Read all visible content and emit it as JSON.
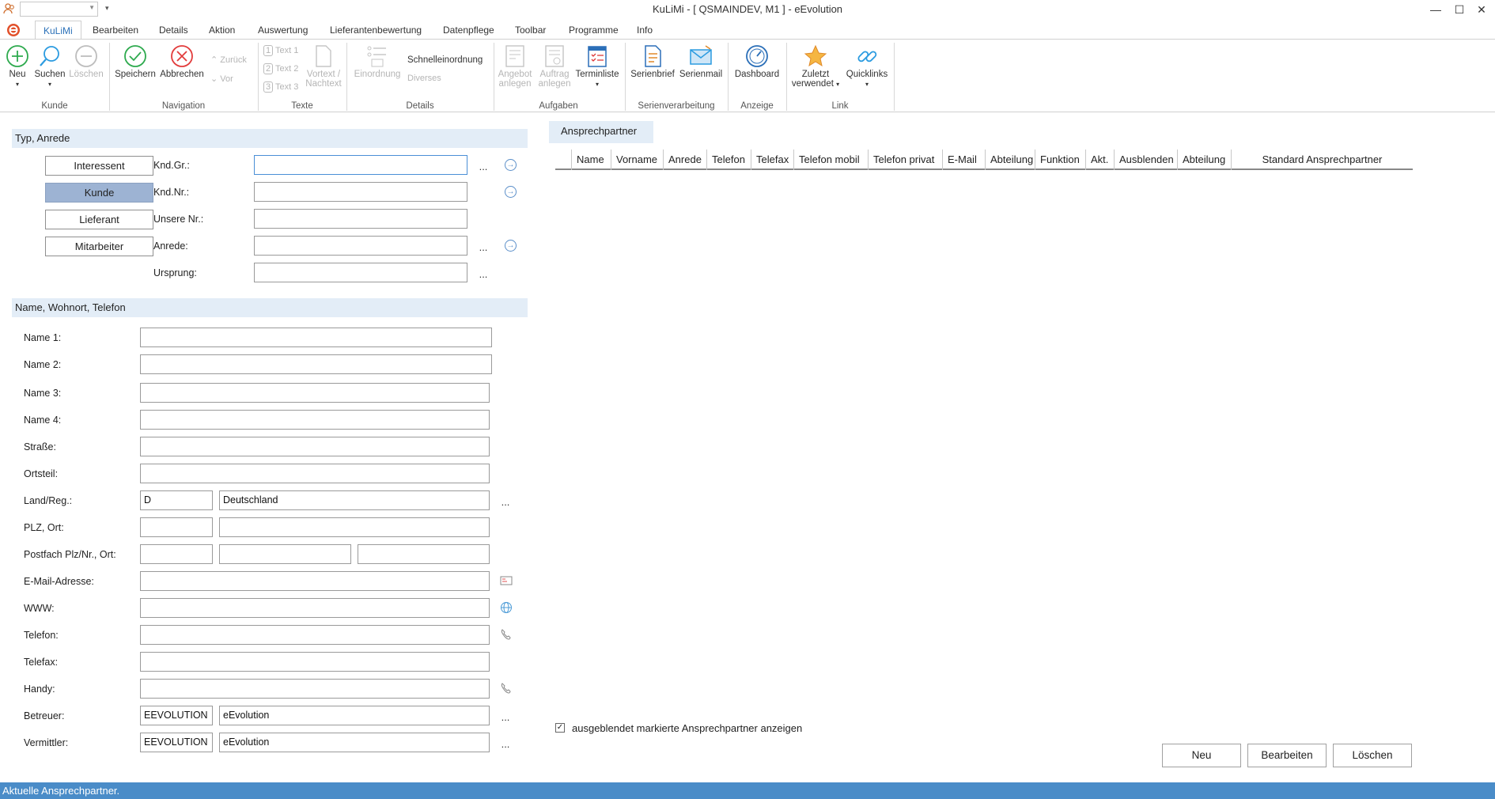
{
  "window": {
    "title": "KuLiMi - [ QSMAINDEV, M1 ]  -  eEvolution",
    "minimize": "—",
    "maximize": "☐",
    "close": "✕"
  },
  "tabs": [
    "KuLiMi",
    "Bearbeiten",
    "Details",
    "Aktion",
    "Auswertung",
    "Lieferantenbewertung",
    "Datenpflege",
    "Toolbar",
    "Programme",
    "Info"
  ],
  "ribbon": {
    "kunde": {
      "label": "Kunde",
      "neu": "Neu",
      "suchen": "Suchen",
      "loeschen": "Löschen"
    },
    "navigation": {
      "label": "Navigation",
      "speichern": "Speichern",
      "abbrechen": "Abbrechen",
      "zurueck": "Zurück",
      "vor": "Vor"
    },
    "texte": {
      "label": "Texte",
      "text1": "Text 1",
      "text2": "Text 2",
      "text3": "Text 3",
      "vortext1": "Vortext /",
      "vortext2": "Nachtext"
    },
    "details": {
      "label": "Details",
      "einordnung": "Einordnung",
      "schnelleinordnung": "Schnelleinordnung",
      "diverses": "Diverses"
    },
    "aufgaben": {
      "label": "Aufgaben",
      "angebot1": "Angebot",
      "angebot2": "anlegen",
      "auftrag1": "Auftrag",
      "auftrag2": "anlegen",
      "terminliste": "Terminliste"
    },
    "serien": {
      "label": "Serienverarbeitung",
      "serienbrief": "Serienbrief",
      "serienmail": "Serienmail"
    },
    "anzeige": {
      "label": "Anzeige",
      "dashboard": "Dashboard"
    },
    "link": {
      "label": "Link",
      "zuletzt1": "Zuletzt",
      "zuletzt2": "verwendet",
      "quicklinks": "Quicklinks"
    }
  },
  "typ_section": {
    "header": "Typ, Anrede",
    "types": [
      "Interessent",
      "Kunde",
      "Lieferant",
      "Mitarbeiter"
    ],
    "selected": "Kunde",
    "fields": [
      {
        "label": "Knd.Gr.:",
        "value": ""
      },
      {
        "label": "Knd.Nr.:",
        "value": ""
      },
      {
        "label": "Unsere Nr.:",
        "value": ""
      },
      {
        "label": "Anrede:",
        "value": ""
      },
      {
        "label": "Ursprung:",
        "value": ""
      }
    ],
    "dots": "..."
  },
  "name_section": {
    "header": "Name, Wohnort, Telefon",
    "labels": {
      "name1": "Name 1:",
      "name2": "Name 2:",
      "name3": "Name 3:",
      "name4": "Name 4:",
      "strasse": "Straße:",
      "ortsteil": "Ortsteil:",
      "land": "Land/Reg.:",
      "plz": "PLZ, Ort:",
      "postfach": "Postfach Plz/Nr., Ort:",
      "email": "E-Mail-Adresse:",
      "www": "WWW:",
      "telefon": "Telefon:",
      "telefax": "Telefax:",
      "handy": "Handy:",
      "betreuer": "Betreuer:",
      "vermittler": "Vermittler:"
    },
    "values": {
      "land_code": "D",
      "land_name": "Deutschland",
      "betreuer_code": "EEVOLUTION",
      "betreuer_name": "eEvolution",
      "vermittler_code": "EEVOLUTION",
      "vermittler_name": "eEvolution"
    }
  },
  "contacts": {
    "tab": "Ansprechpartner",
    "columns": [
      "Name",
      "Vorname",
      "Anrede",
      "Telefon",
      "Telefax",
      "Telefon mobil",
      "Telefon privat",
      "E-Mail",
      "Abteilung",
      "Funktion",
      "Akt.",
      "Ausblenden",
      "Abteilung",
      "Standard Ansprechpartner"
    ],
    "show_hidden_label": "ausgeblendet markierte Ansprechpartner anzeigen",
    "show_hidden_checked": true,
    "buttons": {
      "neu": "Neu",
      "bearbeiten": "Bearbeiten",
      "loeschen": "Löschen"
    }
  },
  "status": "Aktuelle Ansprechpartner.",
  "colors": {
    "accent": "#2a70b8",
    "section_bg": "#e3edf7",
    "statusbar": "#4a8cc8",
    "selected_type": "#9db3d3"
  }
}
